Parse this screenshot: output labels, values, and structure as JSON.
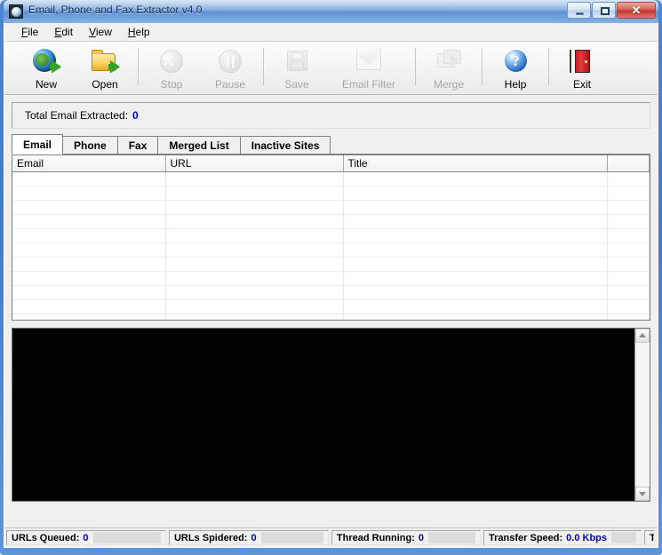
{
  "window": {
    "title": "Email, Phone and Fax Extractor v4.0",
    "app_icon": "globe-icon",
    "minimize_label": "–",
    "maximize_label": "□",
    "close_label": "✕"
  },
  "menubar": {
    "items": [
      {
        "label": "File",
        "accel": "F",
        "rest": "ile"
      },
      {
        "label": "Edit",
        "accel": "E",
        "rest": "dit"
      },
      {
        "label": "View",
        "accel": "V",
        "rest": "iew"
      },
      {
        "label": "Help",
        "accel": "H",
        "rest": "elp"
      }
    ]
  },
  "toolbar": {
    "buttons": [
      {
        "label": "New",
        "icon": "globe-arrow-icon",
        "enabled": true
      },
      {
        "label": "Open",
        "icon": "folder-open-icon",
        "enabled": true
      },
      {
        "label": "Stop",
        "icon": "stop-circle-icon",
        "enabled": false
      },
      {
        "label": "Pause",
        "icon": "pause-circle-icon",
        "enabled": false
      },
      {
        "label": "Save",
        "icon": "floppy-disk-icon",
        "enabled": false
      },
      {
        "label": "Email Filter",
        "icon": "envelope-icon",
        "enabled": false
      },
      {
        "label": "Merge",
        "icon": "merge-folders-icon",
        "enabled": false
      },
      {
        "label": "Help",
        "icon": "help-question-icon",
        "enabled": true
      },
      {
        "label": "Exit",
        "icon": "exit-door-icon",
        "enabled": true
      }
    ]
  },
  "counter": {
    "label": "Total Email Extracted:",
    "value": "0",
    "value_color": "#0000cd"
  },
  "tabs": {
    "active": "Email",
    "items": [
      {
        "label": "Email"
      },
      {
        "label": "Phone"
      },
      {
        "label": "Fax"
      },
      {
        "label": "Merged List"
      },
      {
        "label": "Inactive Sites"
      }
    ]
  },
  "table": {
    "columns": [
      "Email",
      "URL",
      "Title",
      ""
    ],
    "rows": [],
    "empty_row_count": 11
  },
  "log": {
    "text": "",
    "background": "#000000",
    "scroll_up_icon": "triangle-up-icon",
    "scroll_down_icon": "triangle-down-icon"
  },
  "statusbar": {
    "cells": [
      {
        "id": "queued",
        "label": "URLs Queued:",
        "value": "0"
      },
      {
        "id": "spidered",
        "label": "URLs Spidered:",
        "value": "0"
      },
      {
        "id": "thread",
        "label": "Thread Running:",
        "value": "0"
      },
      {
        "id": "speed",
        "label": "Transfer Speed:",
        "value": "0.0 Kbps"
      },
      {
        "id": "last",
        "label": "T",
        "value": ""
      }
    ]
  }
}
